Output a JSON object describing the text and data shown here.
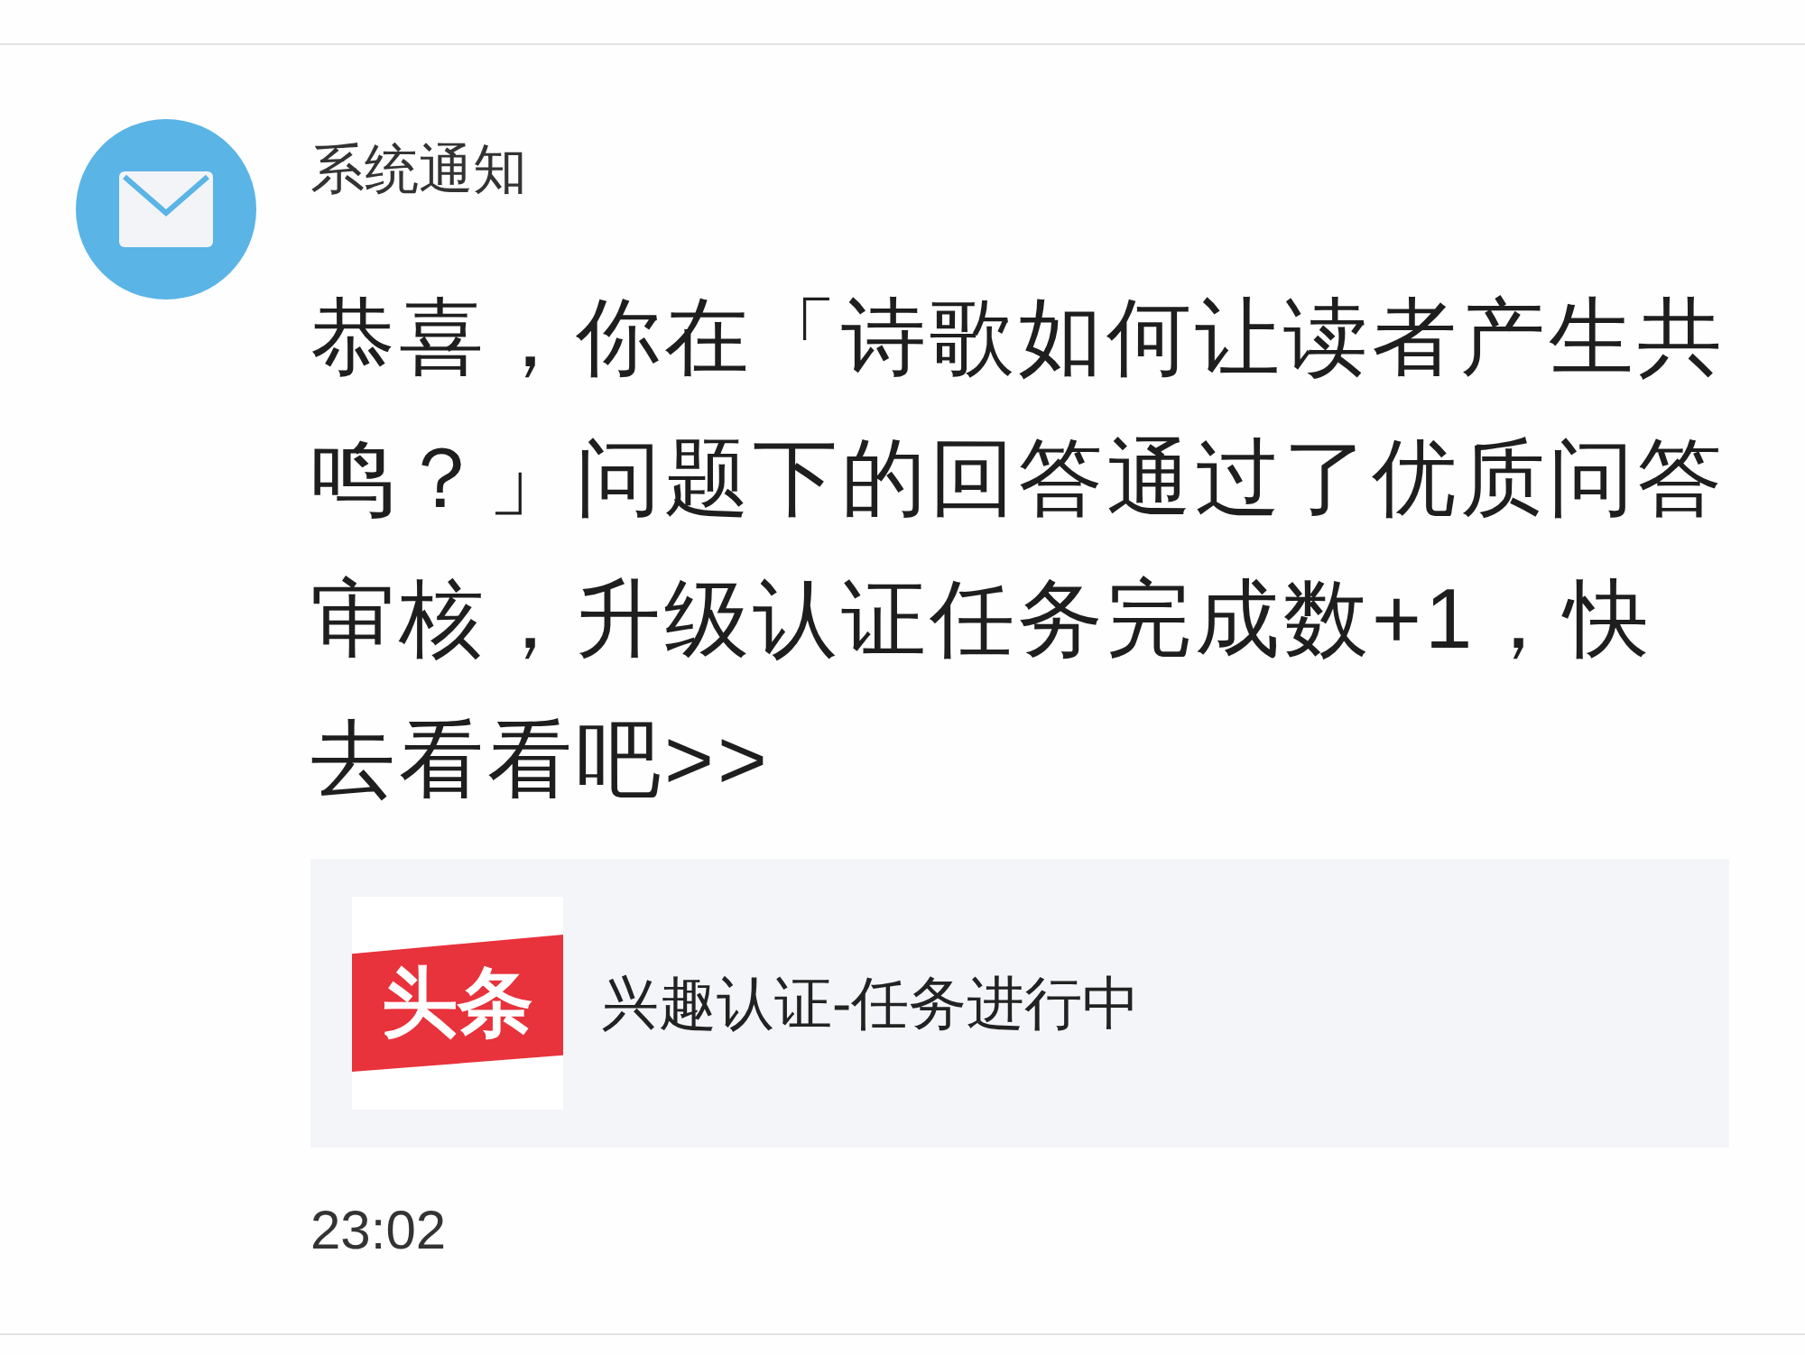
{
  "notification": {
    "sender": "系统通知",
    "message": "恭喜，你在「诗歌如何让读者产生共鸣？」问题下的回答通过了优质问答审核，升级认证任务完成数+1，快去看看吧>>",
    "card": {
      "logo_text": "头条",
      "title": "兴趣认证-任务进行中"
    },
    "time": "23:02"
  }
}
